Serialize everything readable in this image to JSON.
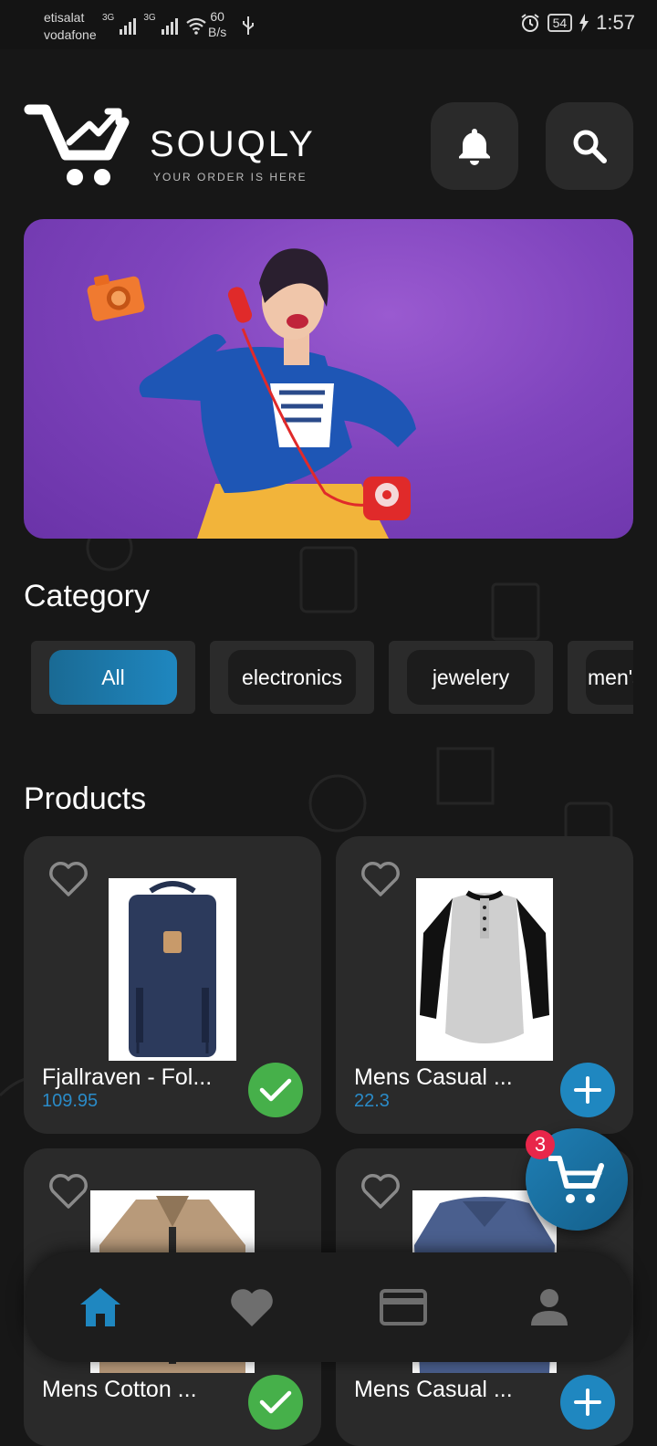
{
  "status_bar": {
    "carrier1": "etisalat",
    "carrier2": "vodafone",
    "net1": "3G",
    "net2": "3G",
    "speed_value": "60",
    "speed_unit": "B/s",
    "battery": "54",
    "time": "1:57"
  },
  "header": {
    "brand": "SOUQLY",
    "tagline": "YOUR ORDER IS HERE",
    "icons": [
      "cart-logo-icon",
      "bell-icon",
      "search-icon"
    ]
  },
  "sections": {
    "category_title": "Category",
    "products_title": "Products"
  },
  "categories": [
    {
      "label": "All",
      "active": true
    },
    {
      "label": "electronics",
      "active": false
    },
    {
      "label": "jewelery",
      "active": false
    },
    {
      "label": "men's clothing",
      "active": false
    }
  ],
  "products": [
    {
      "title": "Fjallraven - Fol...",
      "price": "109.95",
      "in_cart": true
    },
    {
      "title": "Mens Casual ...",
      "price": "22.3",
      "in_cart": false
    },
    {
      "title": "Mens Cotton ...",
      "price": "",
      "in_cart": true
    },
    {
      "title": "Mens Casual ...",
      "price": "",
      "in_cart": false
    }
  ],
  "cart": {
    "count": "3"
  },
  "colors": {
    "accent": "#1f87c0",
    "added": "#46b04a",
    "badge": "#e8264a",
    "background": "#171717",
    "card": "#2a2a2a"
  },
  "bottom_nav": [
    {
      "icon": "home-icon",
      "active": true
    },
    {
      "icon": "heart-icon",
      "active": false
    },
    {
      "icon": "credit-card-icon",
      "active": false
    },
    {
      "icon": "person-icon",
      "active": false
    }
  ]
}
